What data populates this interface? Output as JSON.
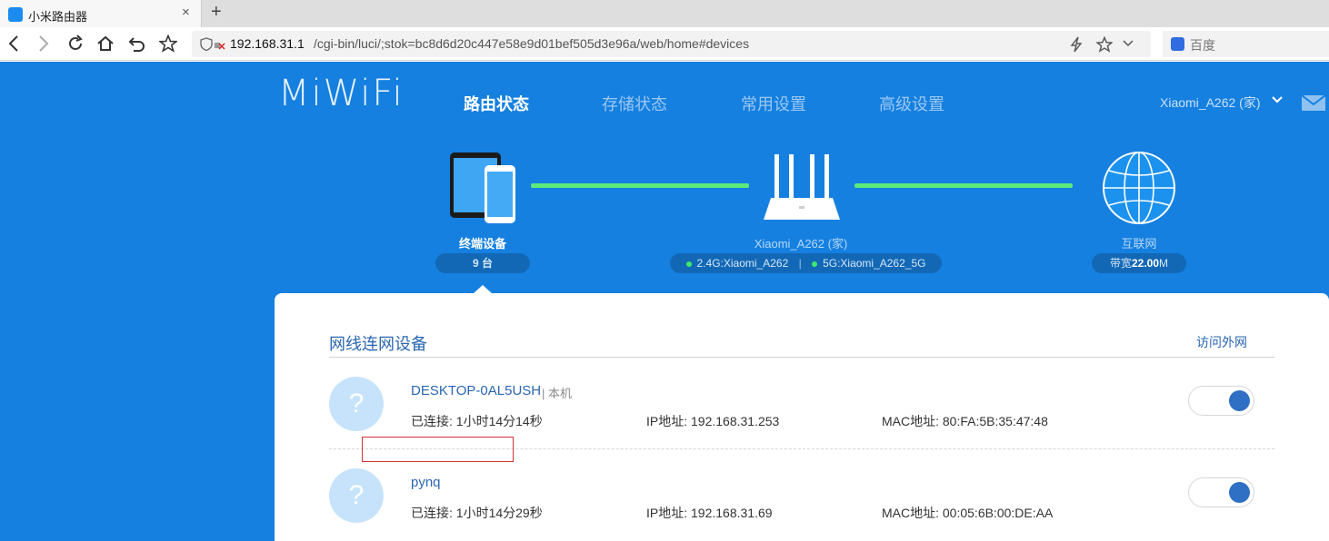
{
  "browser": {
    "tab_title": "小米路由器",
    "tab_close": "×",
    "new_tab": "+",
    "address_host": "192.168.31.1",
    "address_path": "/cgi-bin/luci/;stok=bc8d6d20c447e58e9d01bef505d3e96a/web/home#devices",
    "search_placeholder": "百度"
  },
  "header": {
    "brand": "MiWiFi",
    "menu": [
      "路由状态",
      "存储状态",
      "常用设置",
      "高级设置"
    ],
    "active_menu_index": 0,
    "user": "Xiaomi_A262 (家)"
  },
  "topology": {
    "devices_label": "终端设备",
    "devices_count": "9 台",
    "router_name": "Xiaomi_A262 (家)",
    "wifi_24": "2.4G:Xiaomi_A262",
    "wifi_5": "5G:Xiaomi_A262_5G",
    "wifi_separator": "|",
    "internet_label": "互联网",
    "bandwidth_prefix": "带宽",
    "bandwidth_value": "22.00",
    "bandwidth_unit": "M"
  },
  "device_panel": {
    "title": "网线连网设备",
    "link": "访问外网",
    "devices": [
      {
        "avatar": "?",
        "name": "DESKTOP-0AL5USH",
        "tag": "| 本机",
        "connected": "已连接: 1小时14分14秒",
        "ip": "IP地址: 192.168.31.253",
        "mac": "MAC地址: 80:FA:5B:35:47:48",
        "internet_access": true
      },
      {
        "avatar": "?",
        "name": "pynq",
        "tag": "",
        "connected": "已连接: 1小时14分29秒",
        "ip": "IP地址: 192.168.31.69",
        "mac": "MAC地址: 00:05:6B:00:DE:AA",
        "internet_access": true
      }
    ]
  },
  "colors": {
    "page_blue": "#1580e0",
    "link_green": "#5cea7b",
    "toggle_on": "#2f6fc4",
    "highlight_red": "#d33434"
  }
}
